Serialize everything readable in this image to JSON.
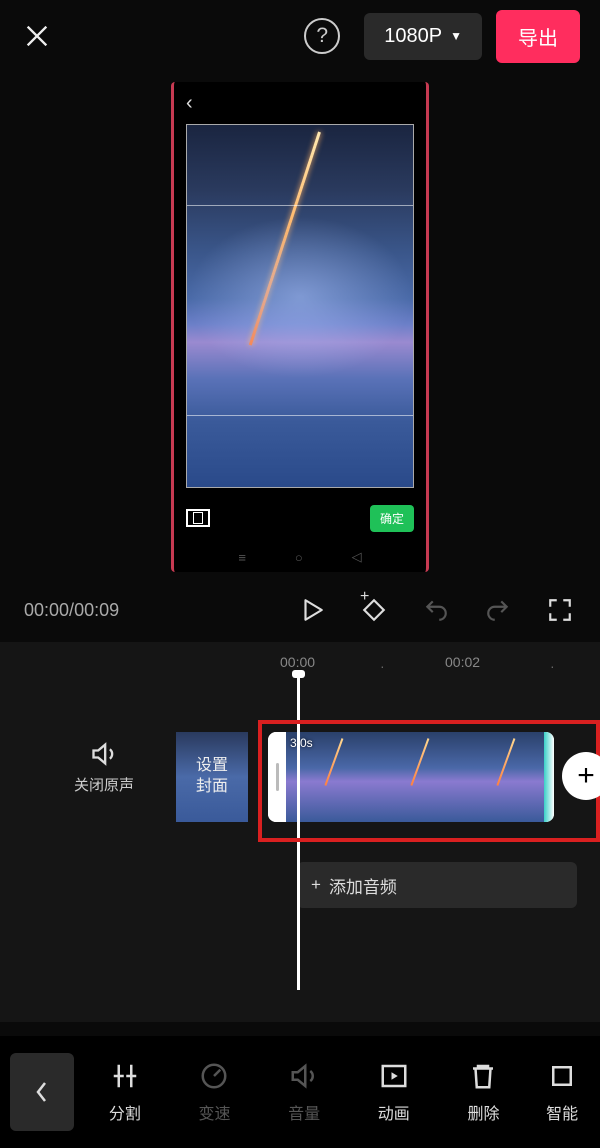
{
  "header": {
    "resolution": "1080P",
    "export": "导出"
  },
  "preview": {
    "confirm": "确定"
  },
  "playback": {
    "current": "00:00",
    "total": "00:09"
  },
  "ruler": {
    "t0": "00:00",
    "t1": "00:02"
  },
  "tracks": {
    "mute_label": "关闭原声",
    "cover_line1": "设置",
    "cover_line2": "封面",
    "clip_duration": "3.0s",
    "add_audio": "添加音频"
  },
  "toolbar": {
    "split": "分割",
    "speed": "变速",
    "volume": "音量",
    "anim": "动画",
    "delete": "删除",
    "smart": "智能"
  }
}
